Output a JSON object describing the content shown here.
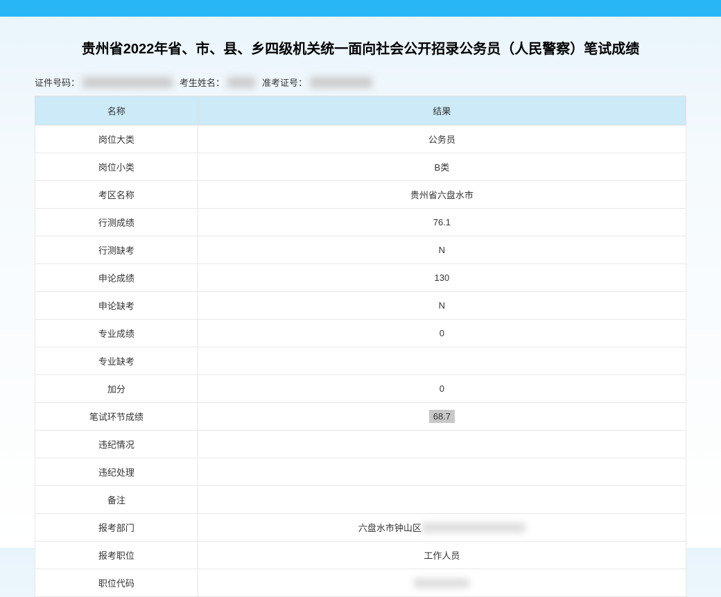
{
  "title": "贵州省2022年省、市、县、乡四级机关统一面向社会公开招录公务员（人民警察）笔试成绩",
  "info": {
    "id_label": "证件号码：",
    "name_label": "考生姓名：",
    "exam_no_label": "准考证号："
  },
  "table": {
    "headers": {
      "name": "名称",
      "result": "结果"
    },
    "rows": [
      {
        "name": "岗位大类",
        "result": "公务员",
        "type": "text"
      },
      {
        "name": "岗位小类",
        "result": "B类",
        "type": "text"
      },
      {
        "name": "考区名称",
        "result": "贵州省六盘水市",
        "type": "text"
      },
      {
        "name": "行测成绩",
        "result": "76.1",
        "type": "text"
      },
      {
        "name": "行测缺考",
        "result": "N",
        "type": "text"
      },
      {
        "name": "申论成绩",
        "result": "130",
        "type": "text"
      },
      {
        "name": "申论缺考",
        "result": "N",
        "type": "text"
      },
      {
        "name": "专业成绩",
        "result": "0",
        "type": "text"
      },
      {
        "name": "专业缺考",
        "result": "",
        "type": "text"
      },
      {
        "name": "加分",
        "result": "0",
        "type": "text"
      },
      {
        "name": "笔试环节成绩",
        "result": "68.7",
        "type": "highlight"
      },
      {
        "name": "违纪情况",
        "result": "",
        "type": "text"
      },
      {
        "name": "违纪处理",
        "result": "",
        "type": "text"
      },
      {
        "name": "备注",
        "result": "",
        "type": "text"
      },
      {
        "name": "报考部门",
        "result": "六盘水市钟山区",
        "type": "dept"
      },
      {
        "name": "报考职位",
        "result": "工作人员",
        "type": "text"
      },
      {
        "name": "职位代码",
        "result": "",
        "type": "blur"
      }
    ]
  }
}
